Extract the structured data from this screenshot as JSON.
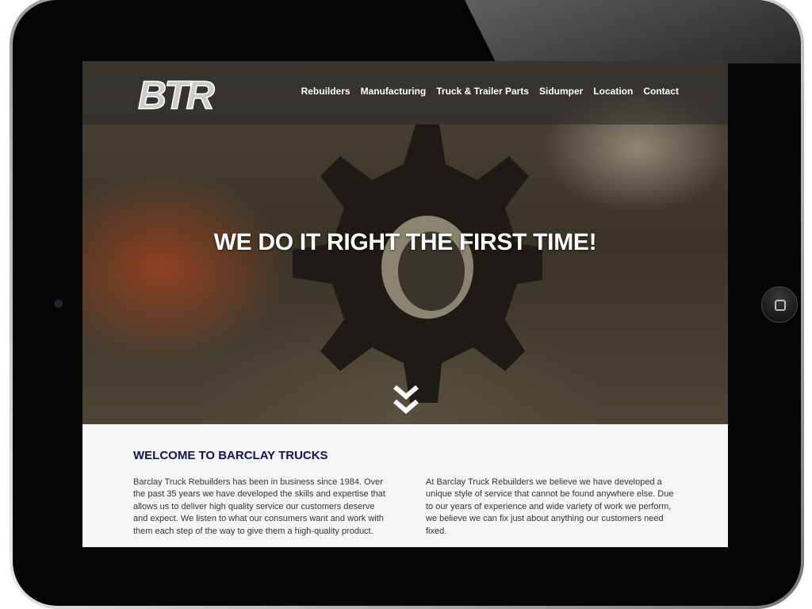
{
  "logo": "BTR",
  "nav": [
    "Rebuilders",
    "Manufacturing",
    "Truck & Trailer Parts",
    "Sidumper",
    "Location",
    "Contact"
  ],
  "hero": {
    "headline": "WE DO IT RIGHT THE FIRST TIME!"
  },
  "welcome": {
    "title": "WELCOME TO BARCLAY TRUCKS",
    "col1": "Barclay Truck Rebuilders has been in business since 1984. Over the past 35 years we have developed the skills and expertise that allows us to deliver high quality service our customers deserve and expect. We listen to what our consumers want and work with them each step of the way to give them a high-quality product.",
    "col2": "At Barclay Truck Rebuilders we believe we have developed a unique style of service that cannot be found anywhere else. Due to our years of experience and wide variety of work we perform, we believe we can fix just about anything our customers need fixed."
  },
  "colors": {
    "heading": "#12145a",
    "bezel": "#050505"
  }
}
